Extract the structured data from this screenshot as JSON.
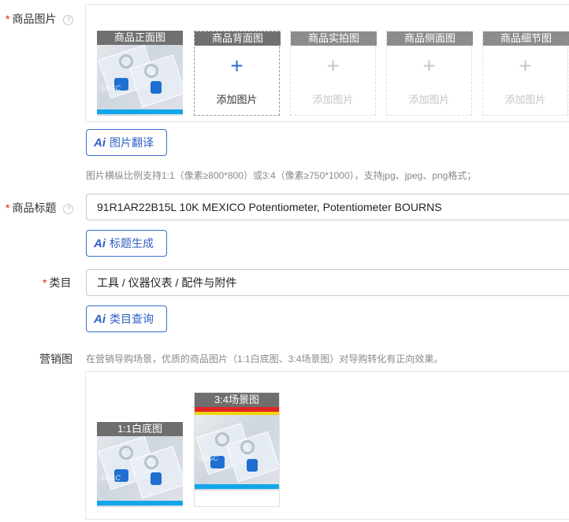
{
  "fields": {
    "product_images": {
      "label": "商品图片",
      "required_mark": "*",
      "help_icon": "question-circle-icon",
      "slots": [
        {
          "title": "商品正面图",
          "has_image": true
        },
        {
          "title": "商品背面图",
          "add_label": "添加图片",
          "active": true
        },
        {
          "title": "商品实拍图",
          "add_label": "添加图片",
          "active": false
        },
        {
          "title": "商品侧面图",
          "add_label": "添加图片",
          "active": false
        },
        {
          "title": "商品细节图",
          "add_label": "添加图片",
          "active": false
        }
      ],
      "plus_symbol": "+",
      "ai_button": {
        "ai_mark": "Ai",
        "label": "图片翻译"
      },
      "hint": "图片横纵比例支持1:1（像素≥800*800）或3:4（像素≥750*1000），支持jpg、jpeg、png格式；"
    },
    "title": {
      "label": "商品标题",
      "required_mark": "*",
      "help_icon": "question-circle-icon",
      "value": "91R1AR22B15L 10K MEXICO Potentiometer, Potentiometer BOURNS",
      "ai_button": {
        "ai_mark": "Ai",
        "label": "标题生成"
      }
    },
    "category": {
      "label": "类目",
      "required_mark": "*",
      "value": "工具 / 仪器仪表 / 配件与附件",
      "ai_button": {
        "ai_mark": "Ai",
        "label": "类目查询"
      }
    },
    "marketing_images": {
      "label": "营销图",
      "hint": "在营销导购场景，优质的商品图片（1:1白底图、3:4场景图）对导购转化有正向效果。",
      "items": [
        {
          "title": "1:1白底图"
        },
        {
          "title": "3:4场景图"
        }
      ]
    }
  },
  "image_watermark": "SDGC",
  "colors": {
    "required": "#e02020",
    "accent": "#2f5fc4",
    "slot_header": "#707070"
  }
}
